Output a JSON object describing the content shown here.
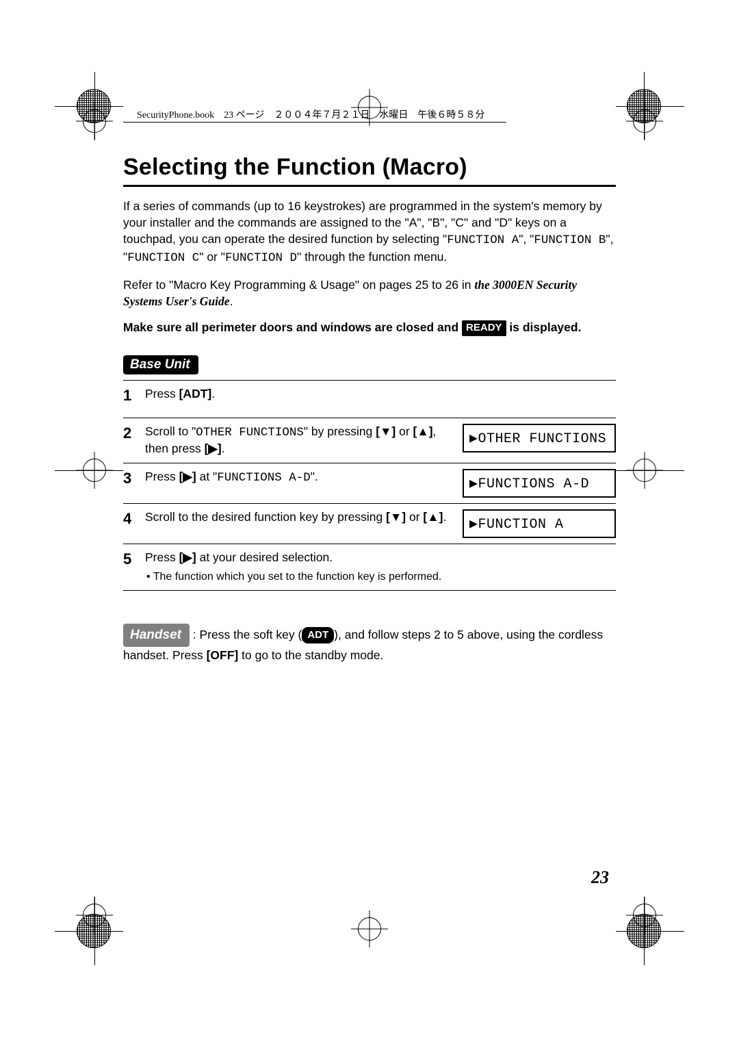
{
  "header": {
    "running": "SecurityPhone.book　23 ページ　２００４年７月２１日　水曜日　午後６時５８分"
  },
  "title": "Selecting the Function (Macro)",
  "intro": {
    "p1a": "If a series of commands (up to 16 keystrokes) are programmed in the system's memory by your installer and the commands are assigned to the \"A\", \"B\", \"C\" and \"D\" keys on a touchpad, you can operate the desired function by selecting \"",
    "fna": "FUNCTION A",
    "p1b": "\", \"",
    "fnb": "FUNCTION B",
    "p1c": "\", \"",
    "fnc": "FUNCTION C",
    "p1d": "\" or \"",
    "fnd": "FUNCTION D",
    "p1e": "\" through the function menu.",
    "p2a": "Refer to \"Macro Key Programming & Usage\" on pages 25 to 26 in ",
    "p2ref": "the 3000EN Security Systems User's Guide",
    "p2b": ".",
    "p3a": "Make sure all perimeter doors and windows are closed and ",
    "p3badge": "READY",
    "p3b": " is displayed."
  },
  "baseUnitLabel": "Base Unit",
  "steps": [
    {
      "num": "1",
      "text_a": "Press ",
      "text_b": "[ADT]",
      "text_c": ".",
      "display": null
    },
    {
      "num": "2",
      "text_a": "Scroll to \"",
      "mono": "OTHER FUNCTIONS",
      "text_b": "\" by pressing ",
      "key1": "[▼]",
      "text_c": " or ",
      "key2": "[▲]",
      "text_d": ", then press ",
      "key3": "[▶]",
      "text_e": ".",
      "display": "▶OTHER FUNCTIONS"
    },
    {
      "num": "3",
      "text_a": "Press ",
      "key1": "[▶]",
      "text_b": " at \"",
      "mono": "FUNCTIONS A-D",
      "text_c": "\".",
      "display": "▶FUNCTIONS A-D"
    },
    {
      "num": "4",
      "text_a": "Scroll to the desired function key by pressing ",
      "key1": "[▼]",
      "text_b": " or ",
      "key2": "[▲]",
      "text_c": ".",
      "display": "▶FUNCTION A"
    },
    {
      "num": "5",
      "text_a": "Press ",
      "key1": "[▶]",
      "text_b": " at your desired selection.",
      "bullet": "• The function which you set to the function key is performed.",
      "display": null
    }
  ],
  "handset": {
    "label": "Handset",
    "text_a": " : Press the soft key (",
    "softkey": "ADT",
    "text_b": "), and follow steps 2 to 5 above, using the cordless handset. Press ",
    "off": "[OFF]",
    "text_c": " to go to the standby mode."
  },
  "pageNumber": "23"
}
